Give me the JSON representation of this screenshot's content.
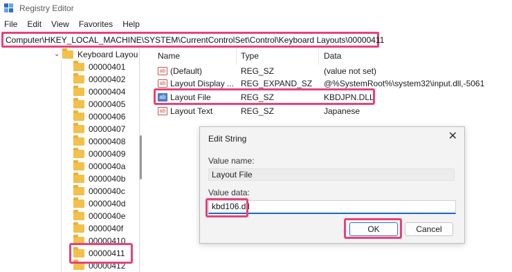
{
  "window": {
    "title": "Registry Editor",
    "icon": "registry-editor-icon"
  },
  "menu": [
    "File",
    "Edit",
    "View",
    "Favorites",
    "Help"
  ],
  "address": "Computer\\HKEY_LOCAL_MACHINE\\SYSTEM\\CurrentControlSet\\Control\\Keyboard Layouts\\00000411",
  "tree": {
    "parent": "Keyboard Layou",
    "items": [
      "00000401",
      "00000402",
      "00000404",
      "00000405",
      "00000406",
      "00000407",
      "00000408",
      "00000409",
      "0000040a",
      "0000040b",
      "0000040c",
      "0000040d",
      "0000040e",
      "0000040f",
      "00000410",
      "00000411",
      "00000412"
    ],
    "selected": "00000411"
  },
  "values": {
    "headers": {
      "name": "Name",
      "type": "Type",
      "data": "Data"
    },
    "rows": [
      {
        "name": "(Default)",
        "type": "REG_SZ",
        "data": "(value not set)",
        "icon": "string-value-icon"
      },
      {
        "name": "Layout Display ...",
        "type": "REG_EXPAND_SZ",
        "data": "@%SystemRoot%\\system32\\input.dll,-5061",
        "icon": "string-value-icon"
      },
      {
        "name": "Layout File",
        "type": "REG_SZ",
        "data": "KBDJPN.DLL",
        "icon": "string-value-icon",
        "selected": true
      },
      {
        "name": "Layout Text",
        "type": "REG_SZ",
        "data": "Japanese",
        "icon": "string-value-icon"
      }
    ]
  },
  "dialog": {
    "title": "Edit String",
    "close_icon": "close-icon",
    "value_name_label": "Value name:",
    "value_name": "Layout File",
    "value_data_label": "Value data:",
    "value_data": "kbd106.dll",
    "ok_label": "OK",
    "cancel_label": "Cancel"
  },
  "colors": {
    "highlight": "#e8417a",
    "accent": "#1a66c2",
    "folder": "#f3c14b"
  }
}
